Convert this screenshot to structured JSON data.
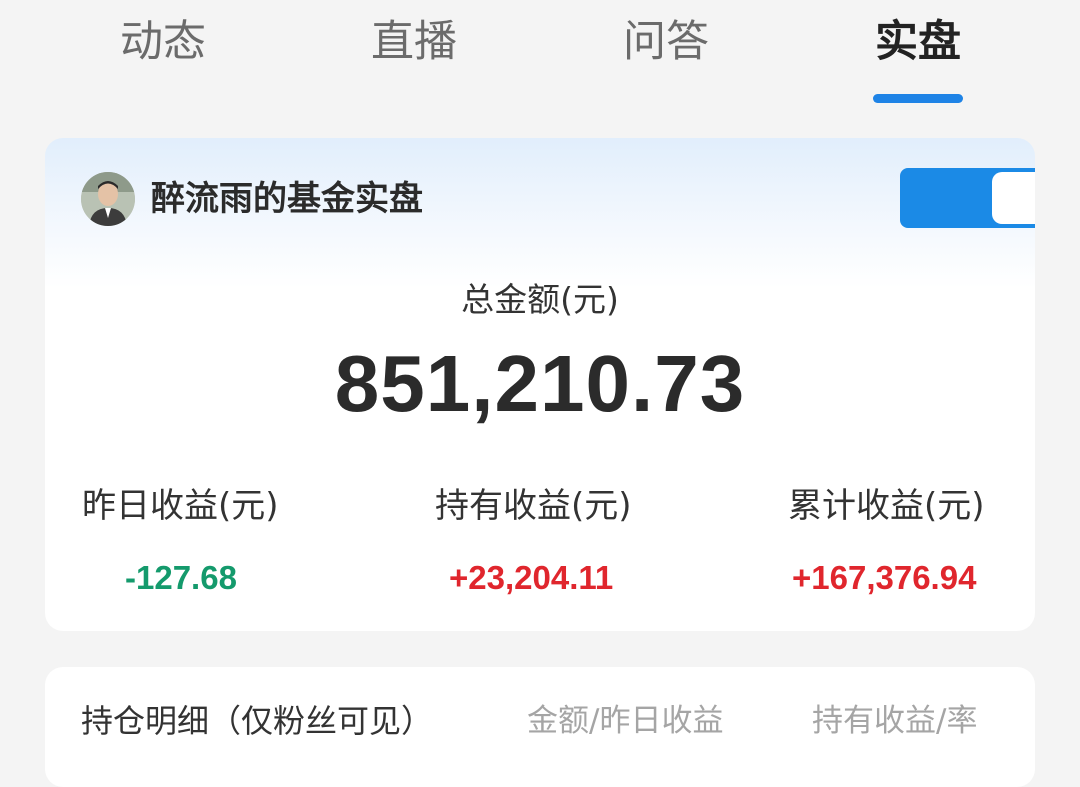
{
  "tabs": [
    {
      "label": "动态",
      "active": false
    },
    {
      "label": "直播",
      "active": false
    },
    {
      "label": "问答",
      "active": false
    },
    {
      "label": "实盘",
      "active": true
    }
  ],
  "colors": {
    "accent": "#1e83e6",
    "loss": "#149a6c",
    "gain": "#e0262d"
  },
  "account": {
    "avatar_icon": "user-avatar",
    "title": "醉流雨的基金实盘",
    "toggle_on": true
  },
  "summary": {
    "total_label": "总金额(元)",
    "total_value": "851,210.73",
    "stats": [
      {
        "label": "昨日收益(元)",
        "value": "-127.68",
        "trend": "loss"
      },
      {
        "label": "持有收益(元)",
        "value": "+23,204.11",
        "trend": "gain"
      },
      {
        "label": "累计收益(元)",
        "value": "+167,376.94",
        "trend": "gain"
      }
    ]
  },
  "holdings": {
    "title": "持仓明细（仅粉丝可见）",
    "columns": [
      "金额/昨日收益",
      "持有收益/率"
    ]
  }
}
